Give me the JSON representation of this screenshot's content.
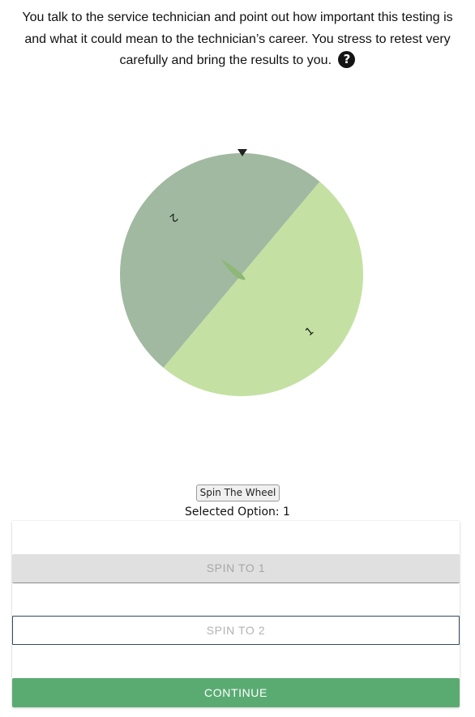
{
  "prompt": {
    "text": "You talk to the service technician and point out how important this testing is and what it could mean to the technician’s career. You stress to retest very carefully and bring the results to you.",
    "help_glyph": "?"
  },
  "wheel": {
    "segments": [
      {
        "label": "1",
        "color": "#c4e1a3"
      },
      {
        "label": "2",
        "color": "#a1b9a0"
      }
    ],
    "center_color": "#8db878",
    "pointer_color": "#222222"
  },
  "spin_button": {
    "label": "Spin The Wheel"
  },
  "selected": {
    "text": "Selected Option: 1"
  },
  "options": {
    "spin_to_1": "SPIN TO 1",
    "spin_to_2": "SPIN TO 2",
    "continue": "CONTINUE"
  }
}
